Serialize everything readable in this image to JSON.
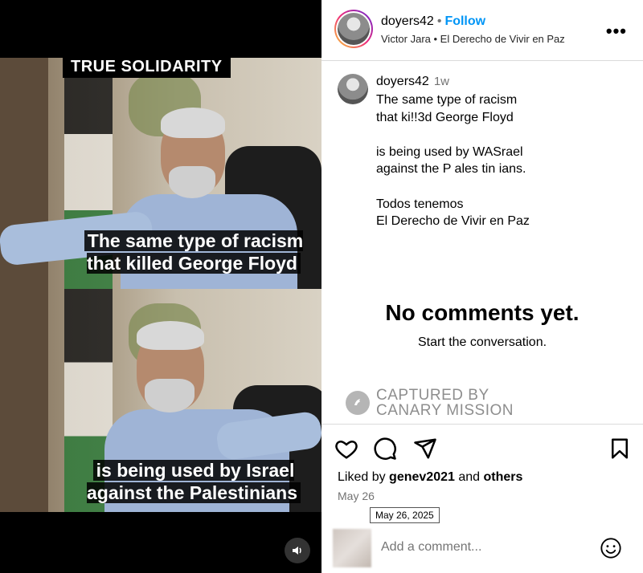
{
  "media": {
    "top_banner": "TRUE SOLIDARITY",
    "subtitle_top": "The same type of racism that killed George Floyd",
    "subtitle_bottom": "is being used by Israel against the Palestinians"
  },
  "header": {
    "username": "doyers42",
    "separator": "•",
    "follow_label": "Follow",
    "audio": "Victor Jara • El Derecho de Vivir en Paz",
    "more_label": "•••"
  },
  "post": {
    "username": "doyers42",
    "time": "1w",
    "caption": "The same type of racism\nthat ki!!3d George Floyd\n\nis being used by WASrael\nagainst the P ales tin ians.\n\nTodos tenemos\nEl Derecho de Vivir en Paz"
  },
  "comments": {
    "empty_title": "No comments yet.",
    "empty_subtitle": "Start the conversation."
  },
  "watermark": {
    "line1": "CAPTURED BY",
    "line2": "CANARY MISSION"
  },
  "actions": {
    "icons": [
      "heart-icon",
      "comment-icon",
      "share-icon",
      "bookmark-icon"
    ]
  },
  "likes": {
    "prefix": "Liked by",
    "user": "genev2021",
    "middle": "and",
    "others": "others"
  },
  "date": {
    "short": "May 26",
    "tooltip": "May 26, 2025"
  },
  "add_comment": {
    "placeholder": "Add a comment..."
  },
  "colors": {
    "follow": "#0095f6",
    "muted": "#737373",
    "border": "#dbdbdb"
  }
}
